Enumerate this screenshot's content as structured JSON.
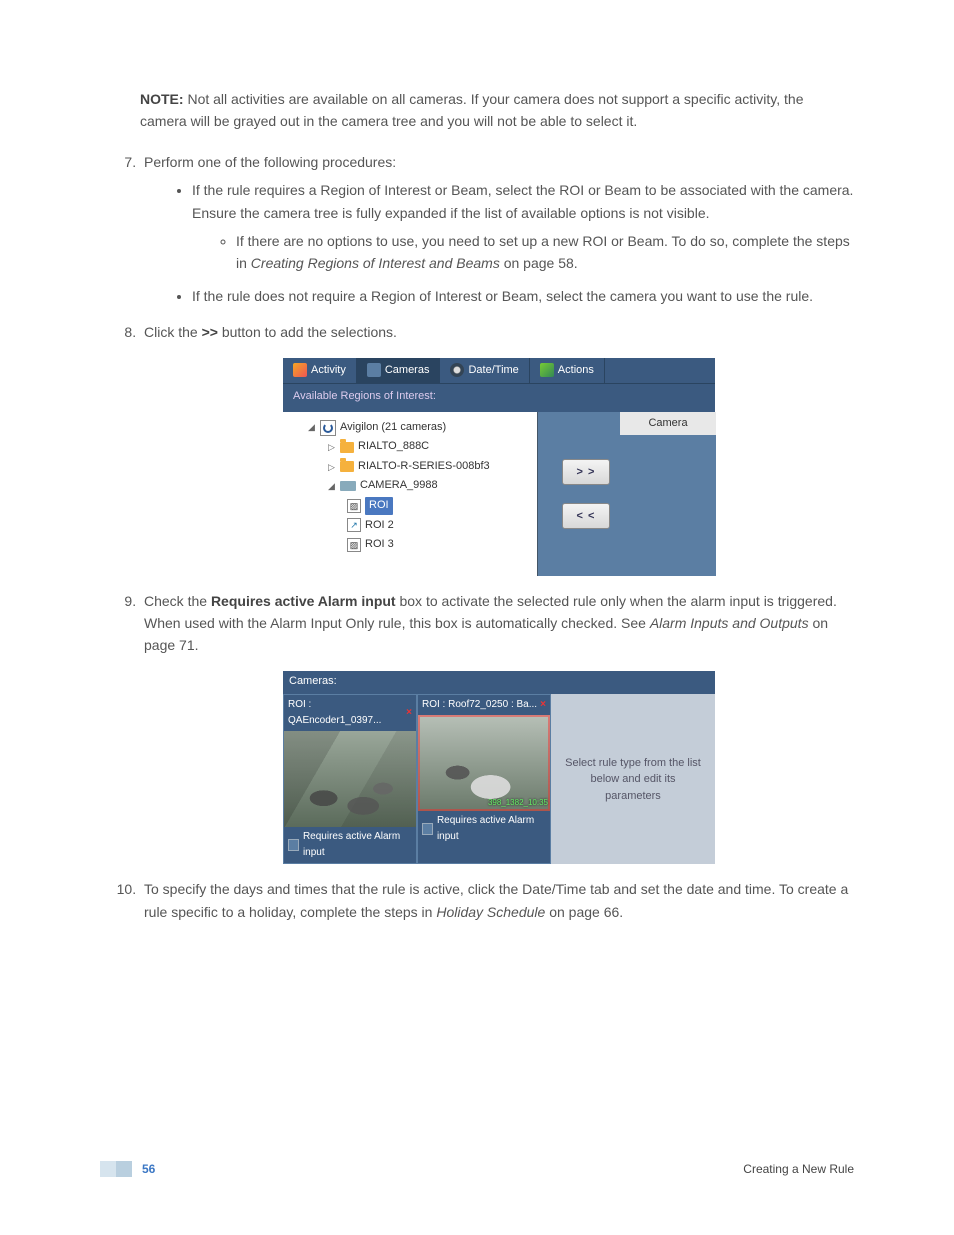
{
  "note": {
    "label": "NOTE:",
    "text": " Not all activities are available on all cameras. If your camera does not support a specific activity, the camera will be grayed out in the camera tree and you will not be able to select it."
  },
  "steps": {
    "s7": "Perform one of the following procedures:",
    "s7_b1": "If the rule requires a Region of Interest or Beam, select the ROI or Beam to be associated with the camera. Ensure the camera tree is fully expanded if the list of available options is not visible.",
    "s7_b1_c1_a": "If there are no options to use, you need to set up a new ROI or Beam. To do so, complete the steps in ",
    "s7_b1_c1_i": "Creating Regions of Interest and Beams",
    "s7_b1_c1_b": " on page 58.",
    "s7_b2": "If the rule does not require a Region of Interest or Beam, select the camera you want to use the rule.",
    "s8_a": "Click the ",
    "s8_b": ">>",
    "s8_c": " button to add the selections.",
    "s9_a": "Check the ",
    "s9_b": "Requires active Alarm input",
    "s9_c": " box to activate the selected rule only when the alarm input is triggered. When used with the Alarm Input Only rule, this box is automatically checked. See ",
    "s9_i": "Alarm Inputs and Outputs",
    "s9_d": " on page 71.",
    "s10_a": "To specify the days and times that the rule is active, click the Date/Time tab and set the date and time. To create a rule specific to a holiday, complete the steps in ",
    "s10_i": "Holiday Schedule",
    "s10_b": " on page 66."
  },
  "shot1": {
    "tabs": {
      "activity": "Activity",
      "cameras": "Cameras",
      "datetime": "Date/Time",
      "actions": "Actions"
    },
    "available": "Available Regions of Interest:",
    "camera_hdr": "Camera",
    "btn_add": "> >",
    "btn_remove": "< <",
    "tree": {
      "root": "Avigilon  (21 cameras)",
      "n1": "RIALTO_888C",
      "n2": "RIALTO-R-SERIES-008bf3",
      "n3": "CAMERA_9988",
      "r1": "ROI",
      "r2": "ROI 2",
      "r3": "ROI 3"
    }
  },
  "shot2": {
    "hdr": "Cameras:",
    "c1_title": "ROI : QAEncoder1_0397...",
    "c2_title": "ROI : Roof72_0250 : Ba...",
    "close": "×",
    "req": "Requires active Alarm input",
    "side": "Select rule type from the list below and edit its parameters",
    "ts": "398_1382_10:35"
  },
  "footer": {
    "page": "56",
    "section": "Creating a New Rule"
  }
}
